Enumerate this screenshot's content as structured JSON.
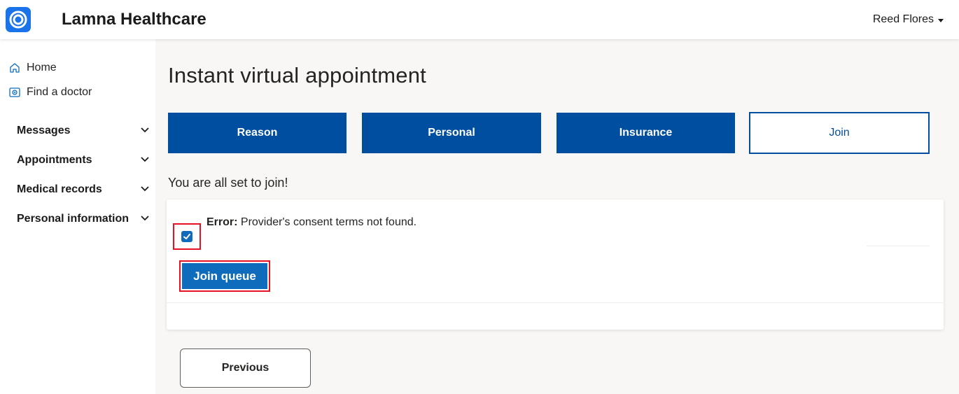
{
  "header": {
    "brand": "Lamna Healthcare",
    "user_name": "Reed Flores",
    "accent_color": "#1a73e8"
  },
  "sidebar": {
    "links": [
      {
        "label": "Home",
        "icon": "home-icon"
      },
      {
        "label": "Find a doctor",
        "icon": "find-doctor-icon"
      }
    ],
    "groups": [
      {
        "label": "Messages"
      },
      {
        "label": "Appointments"
      },
      {
        "label": "Medical records"
      },
      {
        "label": "Personal information"
      }
    ]
  },
  "main": {
    "title": "Instant virtual appointment",
    "steps": [
      {
        "label": "Reason",
        "state": "done"
      },
      {
        "label": "Personal",
        "state": "done"
      },
      {
        "label": "Insurance",
        "state": "done"
      },
      {
        "label": "Join",
        "state": "current"
      }
    ],
    "subtitle": "You are all set to join!",
    "consent": {
      "checked": true,
      "error_label": "Error:",
      "error_text": "Provider's consent terms not found."
    },
    "join_button": "Join queue",
    "previous_button": "Previous"
  },
  "colors": {
    "step_done": "#004e9f",
    "primary_button": "#0f6cbd",
    "highlight_border": "#e81123",
    "page_background": "#f8f7f6"
  }
}
